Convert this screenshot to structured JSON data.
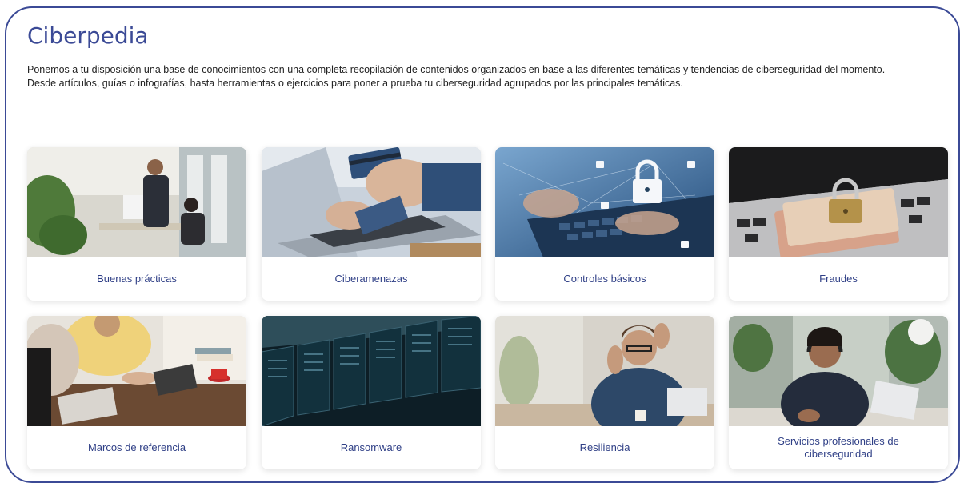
{
  "title": "Ciberpedia",
  "description": {
    "line1": "Ponemos a tu disposición una base de conocimientos con una completa recopilación de contenidos organizados en base a las diferentes temáticas y tendencias de ciberseguridad del momento.",
    "line2": "Desde artículos, guías o infografías, hasta herramientas o ejercicios para poner a prueba tu ciberseguridad agrupados por las principales temáticas."
  },
  "cards": [
    {
      "label": "Buenas prácticas"
    },
    {
      "label": "Ciberamenazas"
    },
    {
      "label": "Controles básicos"
    },
    {
      "label": "Fraudes"
    },
    {
      "label": "Marcos de referencia"
    },
    {
      "label": "Ransomware"
    },
    {
      "label": "Resiliencia"
    },
    {
      "label": "Servicios profesionales de ciberseguridad"
    }
  ],
  "colors": {
    "accent": "#3b4a96",
    "label_text": "#2f3f86"
  }
}
